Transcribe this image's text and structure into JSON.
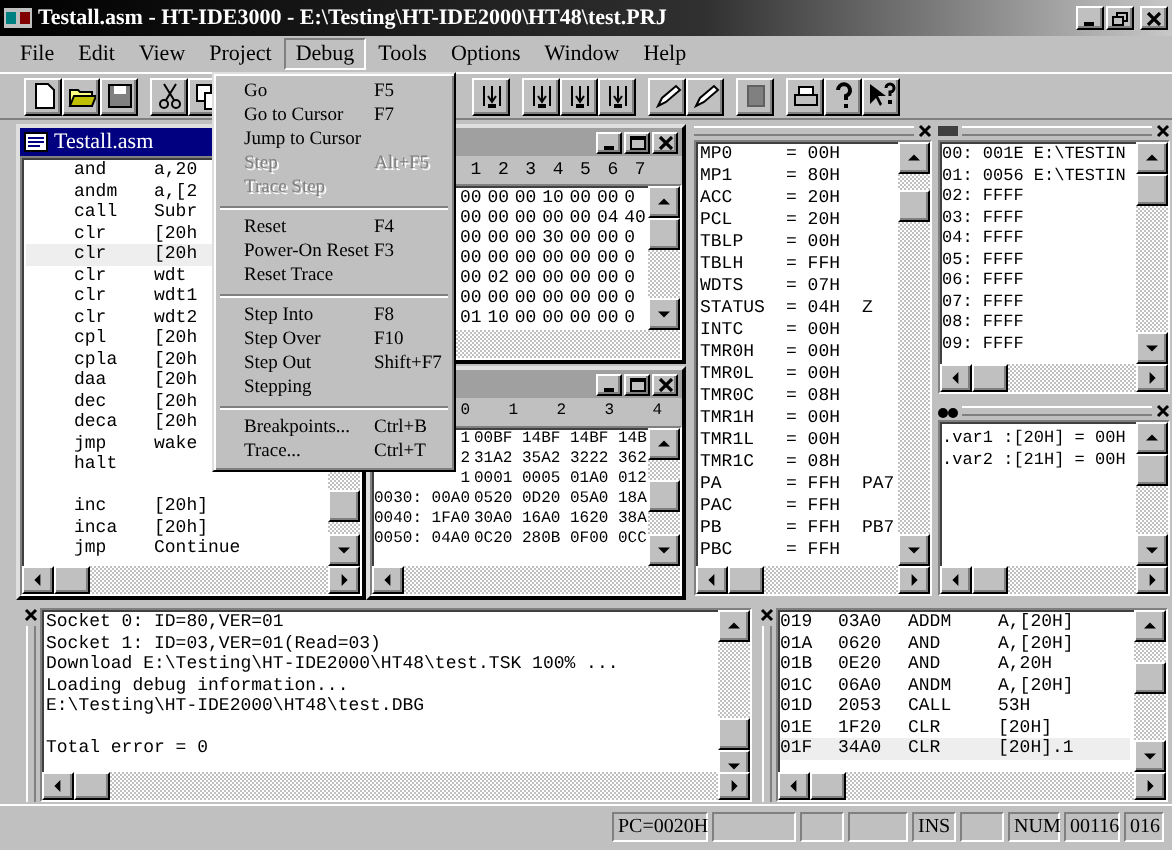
{
  "window": {
    "title": "Testall.asm - HT-IDE3000 - E:\\Testing\\HT-IDE2000\\HT48\\test.PRJ"
  },
  "menu_bar": [
    {
      "label": "File",
      "selected": false
    },
    {
      "label": "Edit",
      "selected": false
    },
    {
      "label": "View",
      "selected": false
    },
    {
      "label": "Project",
      "selected": false
    },
    {
      "label": "Debug",
      "selected": true
    },
    {
      "label": "Tools",
      "selected": false
    },
    {
      "label": "Options",
      "selected": false
    },
    {
      "label": "Window",
      "selected": false
    },
    {
      "label": "Help",
      "selected": false
    }
  ],
  "debug_menu": [
    {
      "kind": "item",
      "label": "Go",
      "shortcut": "F5",
      "disabled": false
    },
    {
      "kind": "item",
      "label": "Go to Cursor",
      "shortcut": "F7",
      "disabled": false
    },
    {
      "kind": "item",
      "label": "Jump to Cursor",
      "disabled": false
    },
    {
      "kind": "item",
      "label": "Step",
      "shortcut": "Alt+F5",
      "disabled": true
    },
    {
      "kind": "item",
      "label": "Trace Step",
      "disabled": true
    },
    {
      "kind": "separator"
    },
    {
      "kind": "item",
      "label": "Reset",
      "shortcut": "F4",
      "disabled": false
    },
    {
      "kind": "item",
      "label": "Power-On Reset",
      "shortcut": "F3",
      "disabled": false
    },
    {
      "kind": "item",
      "label": "Reset Trace",
      "disabled": false
    },
    {
      "kind": "separator"
    },
    {
      "kind": "item",
      "label": "Step Into",
      "shortcut": "F8",
      "disabled": false
    },
    {
      "kind": "item",
      "label": "Step Over",
      "shortcut": "F10",
      "disabled": false
    },
    {
      "kind": "item",
      "label": "Step Out",
      "shortcut": "Shift+F7",
      "disabled": false
    },
    {
      "kind": "item",
      "label": "Stepping",
      "disabled": false
    },
    {
      "kind": "separator"
    },
    {
      "kind": "item",
      "label": "Breakpoints...",
      "shortcut": "Ctrl+B",
      "disabled": false
    },
    {
      "kind": "item",
      "label": "Trace...",
      "shortcut": "Ctrl+T",
      "disabled": false
    }
  ],
  "editor": {
    "title": "Testall.asm",
    "lines": [
      {
        "kind": "code",
        "mnemonic": "and",
        "operand": "a,20",
        "current": false
      },
      {
        "kind": "code",
        "mnemonic": "andm",
        "operand": "a,[2",
        "current": false
      },
      {
        "kind": "code",
        "mnemonic": "call",
        "operand": "Subr",
        "current": false
      },
      {
        "kind": "code",
        "mnemonic": "clr",
        "operand": "[20h",
        "current": false
      },
      {
        "kind": "code",
        "mnemonic": "clr",
        "operand": "[20h",
        "current": true
      },
      {
        "kind": "code",
        "mnemonic": "clr",
        "operand": "wdt",
        "current": false
      },
      {
        "kind": "code",
        "mnemonic": "clr",
        "operand": "wdt1",
        "current": false
      },
      {
        "kind": "code",
        "mnemonic": "clr",
        "operand": "wdt2",
        "current": false
      },
      {
        "kind": "code",
        "mnemonic": "cpl",
        "operand": "[20h",
        "current": false
      },
      {
        "kind": "code",
        "mnemonic": "cpla",
        "operand": "[20h",
        "current": false
      },
      {
        "kind": "code",
        "mnemonic": "daa",
        "operand": "[20h",
        "current": false
      },
      {
        "kind": "code",
        "mnemonic": "dec",
        "operand": "[20h",
        "current": false
      },
      {
        "kind": "code",
        "mnemonic": "deca",
        "operand": "[20h",
        "current": false
      },
      {
        "kind": "code",
        "mnemonic": "jmp",
        "operand": "wake",
        "current": false
      },
      {
        "kind": "code",
        "mnemonic": "halt",
        "current": false
      },
      {
        "kind": "blank"
      },
      {
        "kind": "code",
        "mnemonic": "inc",
        "operand": "[20h]",
        "current": false
      },
      {
        "kind": "code",
        "mnemonic": "inca",
        "operand": "[20h]",
        "current": false
      },
      {
        "kind": "code",
        "mnemonic": "jmp",
        "operand": "Continue",
        "current": false
      }
    ]
  },
  "memory_top": {
    "columns": [
      "1",
      "2",
      "3",
      "4",
      "5",
      "6",
      "7"
    ],
    "rows": [
      {
        "cells": [
          "00",
          "00",
          "00",
          "10",
          "00",
          "00",
          "0"
        ]
      },
      {
        "cells": [
          "00",
          "00",
          "00",
          "00",
          "00",
          "04",
          "40"
        ]
      },
      {
        "cells": [
          "00",
          "00",
          "00",
          "30",
          "00",
          "00",
          "0"
        ]
      },
      {
        "cells": [
          "00",
          "00",
          "00",
          "00",
          "00",
          "00",
          "0"
        ]
      },
      {
        "cells": [
          "00",
          "02",
          "00",
          "00",
          "00",
          "00",
          "0"
        ]
      },
      {
        "cells": [
          "00",
          "00",
          "00",
          "00",
          "00",
          "00",
          "0"
        ]
      },
      {
        "cells": [
          "01",
          "10",
          "00",
          "00",
          "00",
          "00",
          "0"
        ]
      }
    ]
  },
  "memory_bottom": {
    "columns": [
      "0",
      "1",
      "2",
      "3",
      "4"
    ],
    "rows": [
      {
        "cells": [
          "1",
          "00BF",
          "14BF",
          "14BF",
          "14B"
        ]
      },
      {
        "cells": [
          "2",
          "31A2",
          "35A2",
          "3222",
          "362"
        ]
      },
      {
        "cells": [
          "1",
          "0001",
          "0005",
          "01A0",
          "012"
        ]
      },
      {
        "address": "0030:",
        "cells": [
          "00A0",
          "0520",
          "0D20",
          "05A0",
          "18A"
        ]
      },
      {
        "address": "0040:",
        "cells": [
          "1FA0",
          "30A0",
          "16A0",
          "1620",
          "38A"
        ]
      },
      {
        "address": "0050:",
        "cells": [
          "04A0",
          "0C20",
          "280B",
          "0F00",
          "0CC"
        ]
      }
    ]
  },
  "registers": [
    {
      "name": "MP0",
      "value": "= 00H"
    },
    {
      "name": "MP1",
      "value": "= 80H"
    },
    {
      "name": "ACC",
      "value": "= 20H"
    },
    {
      "name": "PCL",
      "value": "= 20H"
    },
    {
      "name": "TBLP",
      "value": "= 00H"
    },
    {
      "name": "TBLH",
      "value": "= FFH"
    },
    {
      "name": "WDTS",
      "value": "= 07H"
    },
    {
      "name": "STATUS",
      "value": "= 04H",
      "flags": "Z"
    },
    {
      "name": "INTC",
      "value": "= 00H"
    },
    {
      "name": "TMR0H",
      "value": "= 00H"
    },
    {
      "name": "TMR0L",
      "value": "= 00H"
    },
    {
      "name": "TMR0C",
      "value": "= 08H"
    },
    {
      "name": "TMR1H",
      "value": "= 00H"
    },
    {
      "name": "TMR1L",
      "value": "= 00H"
    },
    {
      "name": "TMR1C",
      "value": "= 08H"
    },
    {
      "name": "PA",
      "value": "= FFH",
      "flags": "PA7"
    },
    {
      "name": "PAC",
      "value": "= FFH"
    },
    {
      "name": "PB",
      "value": "= FFH",
      "flags": "PB7"
    },
    {
      "name": "PBC",
      "value": "= FFH"
    }
  ],
  "stack": [
    "00: 001E E:\\TESTIN",
    "01: 0056 E:\\TESTIN",
    "02: FFFF",
    "03: FFFF",
    "04: FFFF",
    "05: FFFF",
    "06: FFFF",
    "07: FFFF",
    "08: FFFF",
    "09: FFFF"
  ],
  "watch": [
    ".var1 :[20H] = 00H",
    ".var2 :[21H] = 00H"
  ],
  "output": [
    {
      "kind": "line",
      "text": "Socket 0: ID=80,VER=01"
    },
    {
      "kind": "line",
      "text": "Socket 1: ID=03,VER=01(Read=03)"
    },
    {
      "kind": "line",
      "text": "Download E:\\Testing\\HT-IDE2000\\HT48\\test.TSK 100% ..."
    },
    {
      "kind": "line",
      "text": "Loading debug information..."
    },
    {
      "kind": "line",
      "text": "E:\\Testing\\HT-IDE2000\\HT48\\test.DBG"
    },
    {
      "kind": "blank"
    },
    {
      "kind": "line",
      "text": "Total error = 0"
    }
  ],
  "program": [
    {
      "address": "019",
      "code": "03A0",
      "mnemonic": "ADDM",
      "operand": "A,[20H]",
      "current": false
    },
    {
      "address": "01A",
      "code": "0620",
      "mnemonic": "AND",
      "operand": "A,[20H]",
      "current": false
    },
    {
      "address": "01B",
      "code": "0E20",
      "mnemonic": "AND",
      "operand": "A,20H",
      "current": false
    },
    {
      "address": "01C",
      "code": "06A0",
      "mnemonic": "ANDM",
      "operand": "A,[20H]",
      "current": false
    },
    {
      "address": "01D",
      "code": "2053",
      "mnemonic": "CALL",
      "operand": "53H",
      "current": false
    },
    {
      "address": "01E",
      "code": "1F20",
      "mnemonic": "CLR",
      "operand": "[20H]",
      "current": false
    },
    {
      "address": "01F",
      "code": "34A0",
      "mnemonic": "CLR",
      "operand": "[20H].1",
      "current": true
    }
  ],
  "status_bar": {
    "pc": "PC=0020H",
    "insert": "INS",
    "num": "NUM",
    "line": "00116",
    "column": "016"
  }
}
